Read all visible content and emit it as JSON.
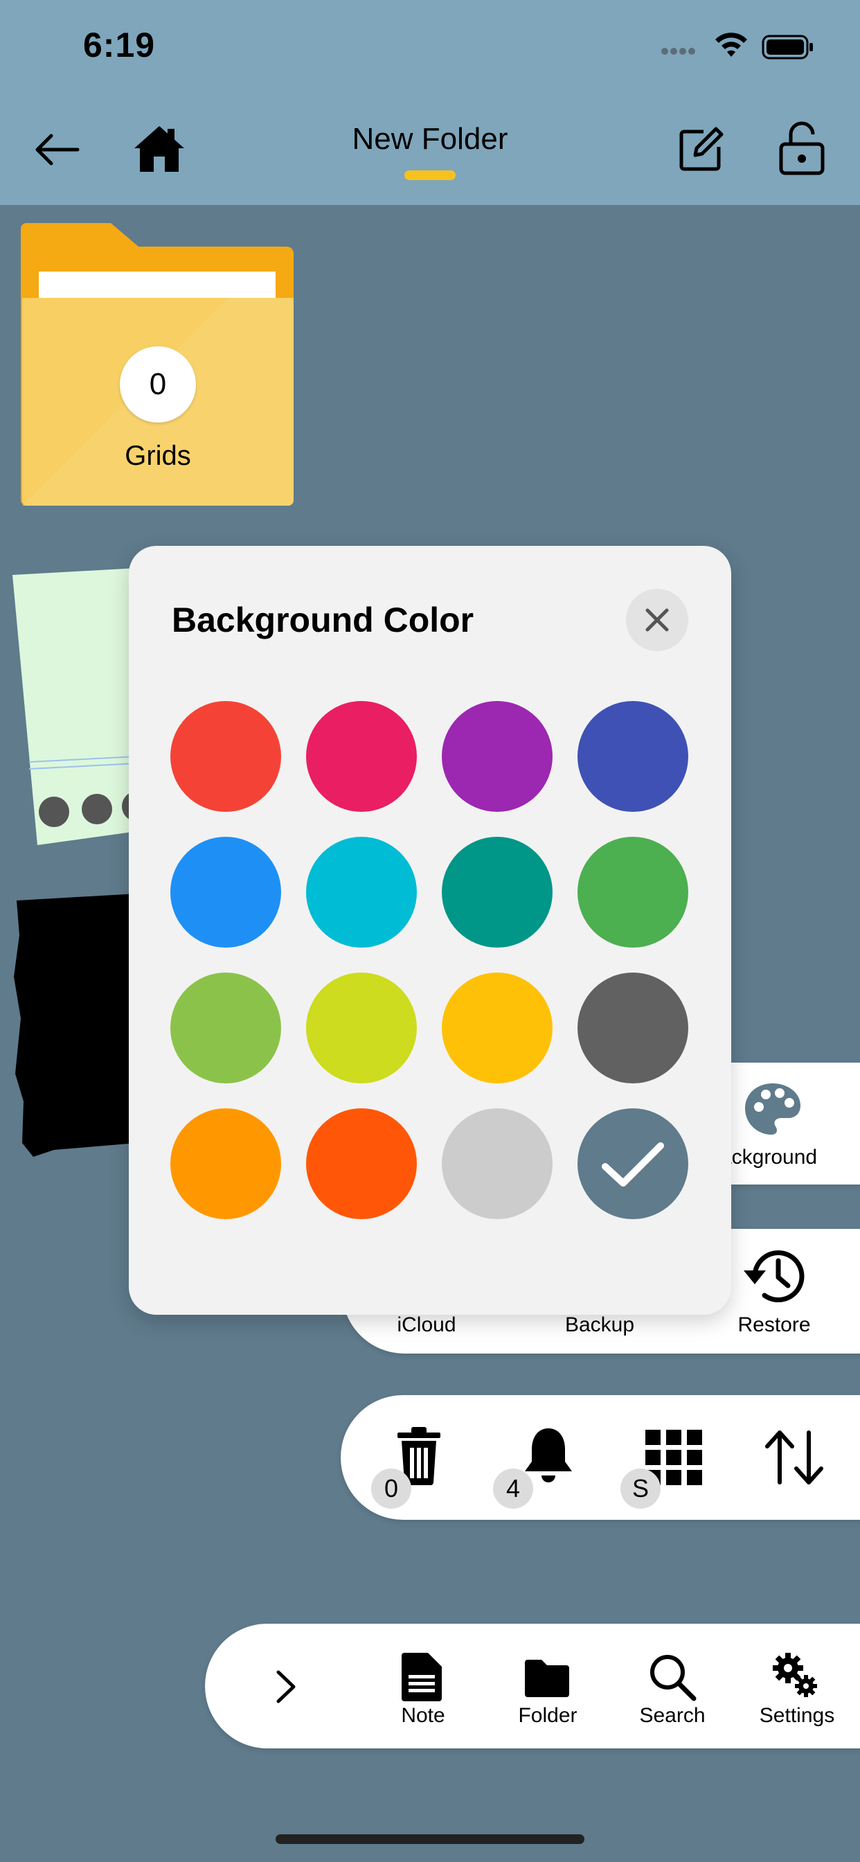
{
  "status_bar": {
    "time": "6:19"
  },
  "header": {
    "title": "New Folder"
  },
  "folder": {
    "count": "0",
    "label": "Grids"
  },
  "modal": {
    "title": "Background Color",
    "colors": [
      {
        "hex": "#f44336",
        "selected": false
      },
      {
        "hex": "#e91e63",
        "selected": false
      },
      {
        "hex": "#9c27b0",
        "selected": false
      },
      {
        "hex": "#3f51b5",
        "selected": false
      },
      {
        "hex": "#1e90f5",
        "selected": false
      },
      {
        "hex": "#00bcd4",
        "selected": false
      },
      {
        "hex": "#009688",
        "selected": false
      },
      {
        "hex": "#4caf50",
        "selected": false
      },
      {
        "hex": "#8bc34a",
        "selected": false
      },
      {
        "hex": "#cddc1e",
        "selected": false
      },
      {
        "hex": "#ffc107",
        "selected": false
      },
      {
        "hex": "#616161",
        "selected": false
      },
      {
        "hex": "#ff9800",
        "selected": false
      },
      {
        "hex": "#ff5707",
        "selected": false
      },
      {
        "hex": "#cccccc",
        "selected": false
      },
      {
        "hex": "#5f7b8c",
        "selected": true
      }
    ]
  },
  "background_bar": {
    "label": "ackground"
  },
  "backup_bar": {
    "icloud": "iCloud",
    "backup": "Backup",
    "restore": "Restore"
  },
  "tool_bar": {
    "trash_count": "0",
    "bell_count": "4",
    "grid_badge": "S"
  },
  "nav": {
    "note": "Note",
    "folder": "Folder",
    "search": "Search",
    "settings": "Settings"
  },
  "colors": {
    "header_bg": "#7fa6bb",
    "page_bg": "#5f7b8c",
    "accent": "#f8c21d",
    "folder": "#f7cf62"
  },
  "icons": [
    "back-arrow-icon",
    "home-icon",
    "edit-icon",
    "lock-icon",
    "palette-icon",
    "restore-icon",
    "trash-icon",
    "bell-icon",
    "grid-icon",
    "sort-icon",
    "chevron-right-icon",
    "note-icon",
    "folder-icon",
    "search-icon",
    "settings-icon",
    "close-icon",
    "checkmark-icon"
  ]
}
